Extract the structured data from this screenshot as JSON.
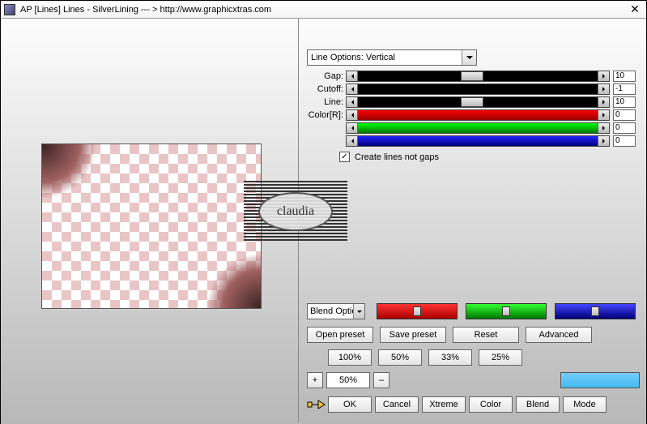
{
  "title": "AP [Lines]  Lines - SilverLining    --- >  http://www.graphicxtras.com",
  "line_options_selected": "Line Options: Vertical",
  "params": {
    "gap": {
      "label": "Gap:",
      "value": "10"
    },
    "cutoff": {
      "label": "Cutoff:",
      "value": "-1"
    },
    "line": {
      "label": "Line:",
      "value": "10"
    },
    "colorR": {
      "label": "Color[R]:",
      "r": "0",
      "g": "0",
      "b": "0"
    }
  },
  "create_lines_not_gaps": {
    "label": "Create lines not gaps",
    "checked": true
  },
  "blend_options_selected": "Blend Options",
  "buttons": {
    "open_preset": "Open preset",
    "save_preset": "Save preset",
    "reset": "Reset",
    "advanced": "Advanced",
    "p100": "100%",
    "p50": "50%",
    "p33": "33%",
    "p25": "25%",
    "zoom_in": "+",
    "zoom_out": "–",
    "zoom_value": "50%",
    "ok": "OK",
    "cancel": "Cancel",
    "xtreme": "Xtreme",
    "color": "Color",
    "blend": "Blend",
    "mode": "Mode"
  },
  "watermark": "claudia"
}
